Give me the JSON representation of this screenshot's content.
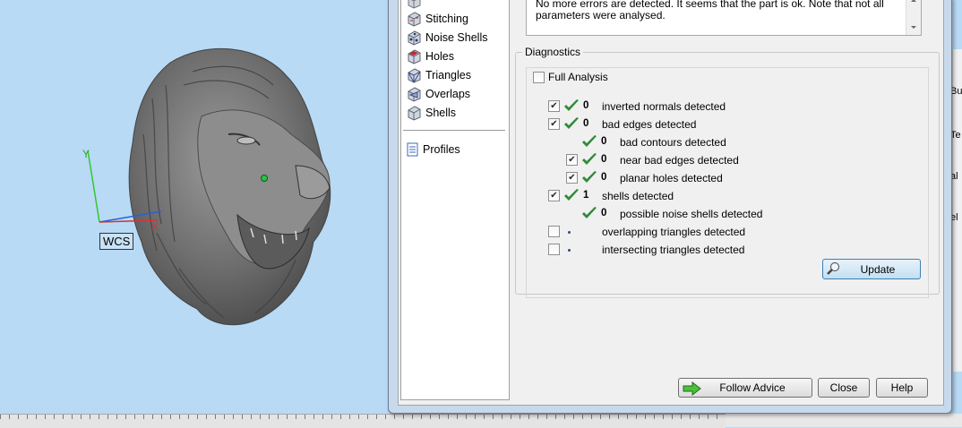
{
  "viewport": {
    "wcs_label": "WCS",
    "axis_y_label": "Y",
    "axis_x_label": "X"
  },
  "sidebar": {
    "items": [
      {
        "label": "Stitching",
        "icon": "stitching-cube-icon"
      },
      {
        "label": "Noise Shells",
        "icon": "noise-shells-cube-icon"
      },
      {
        "label": "Holes",
        "icon": "holes-cube-icon"
      },
      {
        "label": "Triangles",
        "icon": "triangles-cube-icon"
      },
      {
        "label": "Overlaps",
        "icon": "overlaps-cube-icon"
      },
      {
        "label": "Shells",
        "icon": "shells-cube-icon"
      }
    ],
    "profiles_label": "Profiles"
  },
  "advice": {
    "line1": "No more errors are detected. It seems that the part is ok. Note that not all",
    "line2": "parameters were analysed."
  },
  "diagnostics": {
    "legend": "Diagnostics",
    "full_analysis_label": "Full Analysis",
    "full_analysis_checked": false,
    "rows": [
      {
        "checked": true,
        "status": "ok",
        "count": "0",
        "label": "inverted normals detected"
      },
      {
        "checked": true,
        "status": "ok",
        "count": "0",
        "label": "bad edges detected"
      },
      {
        "checked": null,
        "status": "ok",
        "count": "0",
        "label": "bad contours detected"
      },
      {
        "checked": true,
        "status": "ok",
        "count": "0",
        "label": "near bad edges detected"
      },
      {
        "checked": true,
        "status": "ok",
        "count": "0",
        "label": "planar holes detected"
      },
      {
        "checked": true,
        "status": "ok",
        "count": "1",
        "label": "shells detected"
      },
      {
        "checked": null,
        "status": "ok",
        "count": "0",
        "label": "possible noise shells detected"
      },
      {
        "checked": false,
        "status": "pending",
        "count": "",
        "label": "overlapping triangles detected"
      },
      {
        "checked": false,
        "status": "pending",
        "count": "",
        "label": "intersecting triangles detected"
      }
    ],
    "update_label": "Update"
  },
  "footer": {
    "follow_advice_label": "Follow Advice",
    "close_label": "Close",
    "help_label": "Help"
  },
  "right_strip": {
    "fragments": [
      "Bu",
      "Te",
      "al",
      "el"
    ]
  },
  "colors": {
    "viewport_bg": "#b8daf5",
    "check_green": "#2e8b3a",
    "dialog_frame": "#c9d9ec"
  }
}
